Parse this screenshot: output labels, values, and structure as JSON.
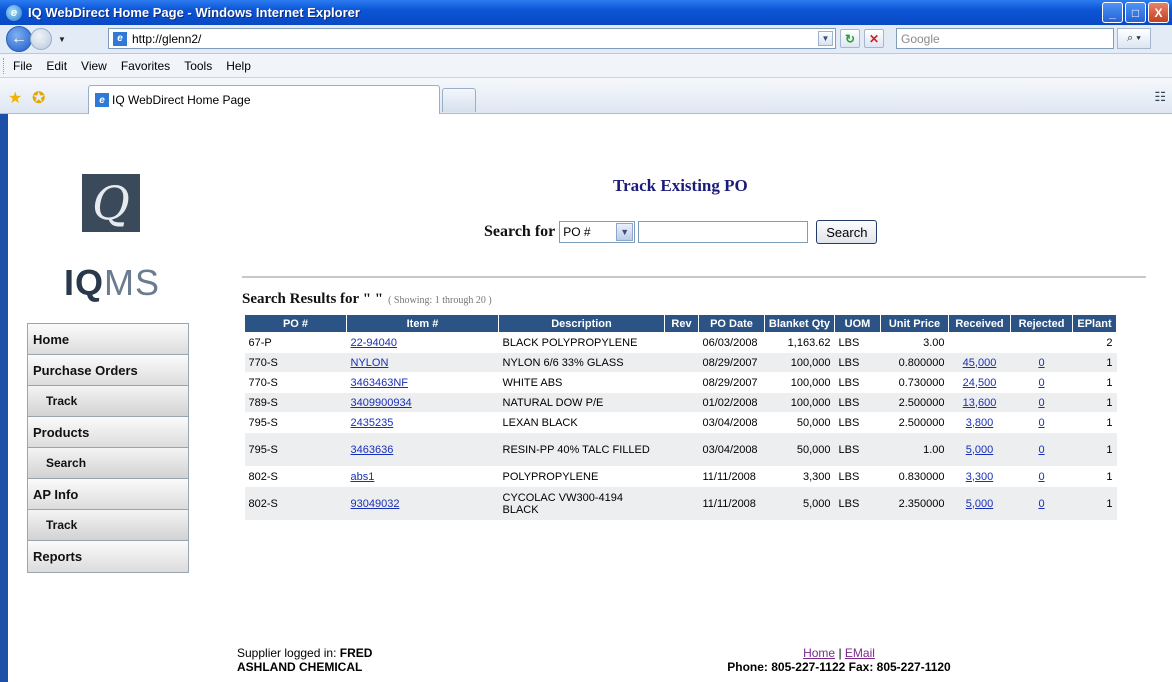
{
  "window": {
    "title": "IQ WebDirect Home Page - Windows Internet Explorer",
    "buttons": [
      "_",
      "□",
      "X"
    ]
  },
  "toolbar": {
    "url": "http://glenn2/",
    "search_placeholder": "Google",
    "search_go": "⌕ ▾"
  },
  "menu": [
    "File",
    "Edit",
    "View",
    "Favorites",
    "Tools",
    "Help"
  ],
  "tab": {
    "label": "IQ WebDirect Home Page"
  },
  "logo": {
    "symbol": "Q",
    "text_bold": "IQ",
    "text_light": "MS"
  },
  "sidebar": {
    "items": [
      {
        "label": "Home",
        "sub": false
      },
      {
        "label": "Purchase Orders",
        "sub": false
      },
      {
        "label": "Track",
        "sub": true
      },
      {
        "label": "Products",
        "sub": false
      },
      {
        "label": "Search",
        "sub": true
      },
      {
        "label": "AP Info",
        "sub": false
      },
      {
        "label": "Track",
        "sub": true
      },
      {
        "label": "Reports",
        "sub": false
      }
    ]
  },
  "main": {
    "title": "Track Existing PO",
    "search_label": "Search for",
    "search_field_selected": "PO #",
    "search_value": "",
    "search_button": "Search",
    "results_title": "Search Results for \" \"",
    "showing": "( Showing: 1 through 20 )"
  },
  "table": {
    "columns": [
      "PO #",
      "Item #",
      "Description",
      "Rev",
      "PO Date",
      "Blanket Qty",
      "UOM",
      "Unit Price",
      "Received",
      "Rejected",
      "EPlant"
    ],
    "rows": [
      [
        "67-P",
        "22-94040",
        "BLACK POLYPROPYLENE",
        "",
        "06/03/2008",
        "1,163.62",
        "LBS",
        "3.00",
        "",
        "",
        "2"
      ],
      [
        "770-S",
        "NYLON",
        "NYLON 6/6 33% GLASS",
        "",
        "08/29/2007",
        "100,000",
        "LBS",
        "0.800000",
        "45,000",
        "0",
        "1"
      ],
      [
        "770-S",
        "3463463NF",
        "WHITE ABS",
        "",
        "08/29/2007",
        "100,000",
        "LBS",
        "0.730000",
        "24,500",
        "0",
        "1"
      ],
      [
        "789-S",
        "3409900934",
        "NATURAL DOW P/E",
        "",
        "01/02/2008",
        "100,000",
        "LBS",
        "2.500000",
        "13,600",
        "0",
        "1"
      ],
      [
        "795-S",
        "2435235",
        "LEXAN BLACK",
        "",
        "03/04/2008",
        "50,000",
        "LBS",
        "2.500000",
        "3,800",
        "0",
        "1"
      ],
      [
        "795-S",
        "3463636",
        "RESIN-PP 40% TALC FILLED",
        "",
        "03/04/2008",
        "50,000",
        "LBS",
        "1.00",
        "5,000",
        "0",
        "1"
      ],
      [
        "802-S",
        "abs1",
        "POLYPROPYLENE",
        "",
        "11/11/2008",
        "3,300",
        "LBS",
        "0.830000",
        "3,300",
        "0",
        "1"
      ],
      [
        "802-S",
        "93049032",
        "CYCOLAC VW300-4194 BLACK",
        "",
        "11/11/2008",
        "5,000",
        "LBS",
        "2.350000",
        "5,000",
        "0",
        "1"
      ]
    ]
  },
  "footer": {
    "logged_in_label": "Supplier logged in:",
    "user": "FRED",
    "company": "ASHLAND CHEMICAL",
    "home_link": "Home",
    "separator": "|",
    "email_link": "EMail",
    "phone": "Phone: 805-227-1122  Fax: 805-227-1120"
  }
}
